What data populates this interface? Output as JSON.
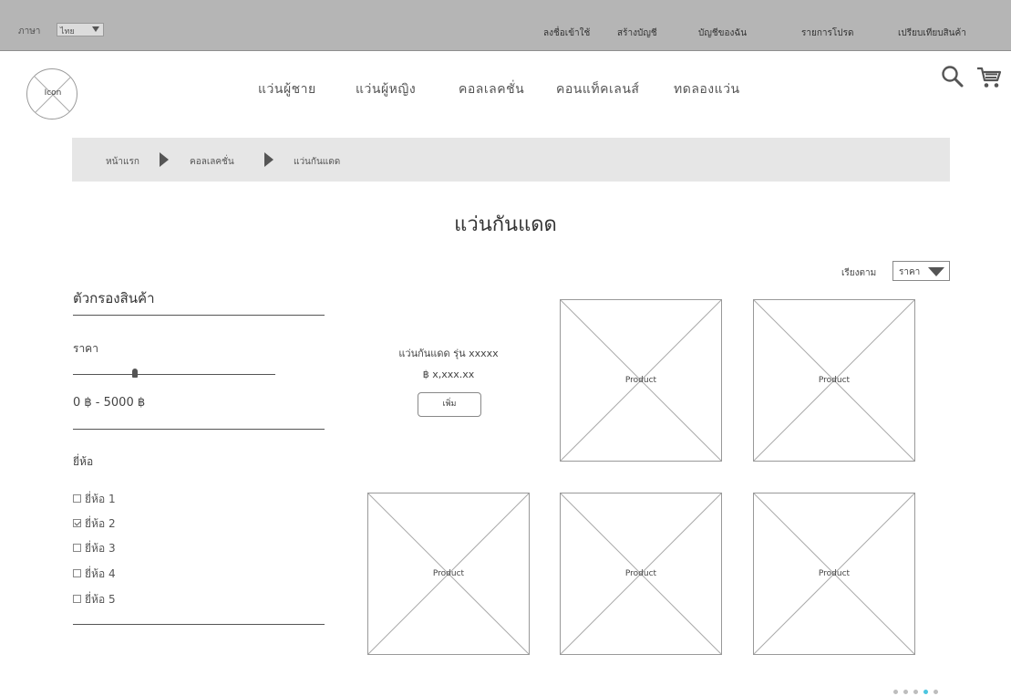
{
  "topbar": {
    "language_label": "ภาษา",
    "language_value": "ไทย",
    "links": [
      "ลงชื่อเข้าใช้",
      "สร้างบัญชี",
      "บัญชีของฉัน",
      "รายการโปรด",
      "เปรียบเทียบสินค้า"
    ]
  },
  "header": {
    "logo_text": "Icon",
    "nav": [
      "แว่นผู้ชาย",
      "แว่นผู้หญิง",
      "คอลเลคชั่น",
      "คอนแท็คเลนส์",
      "ทดลองแว่น"
    ]
  },
  "breadcrumb": [
    "หน้าแรก",
    "คอลเลคชั่น",
    "แว่นกันแดด"
  ],
  "page": {
    "title": "แว่นกันแดด",
    "sort_label": "เรียงตาม",
    "sort_value": "ราคา"
  },
  "filter": {
    "title": "ตัวกรองสินค้า",
    "price_label": "ราคา",
    "price_range": "0 ฿ - 5000 ฿",
    "price_slider_value": 0.3,
    "brand_label": "ยี่ห้อ",
    "brands": [
      {
        "label": "ยี่ห้อ 1",
        "checked": false
      },
      {
        "label": "ยี่ห้อ 2",
        "checked": true
      },
      {
        "label": "ยี่ห้อ 3",
        "checked": false
      },
      {
        "label": "ยี่ห้อ 4",
        "checked": false
      },
      {
        "label": "ยี่ห้อ 5",
        "checked": false
      }
    ]
  },
  "products": {
    "featured": {
      "name": "แว่นกันแดด รุ่น xxxxx",
      "price": "฿ x,xxx.xx",
      "add_label": "เพิ่ม"
    },
    "placeholders": [
      "Product",
      "Product",
      "Product",
      "Product",
      "Product"
    ]
  },
  "pagination": {
    "pages": 5,
    "active_index": 3
  },
  "colors": {
    "topbar": "#b5b5b5",
    "breadcrumb_bg": "#e6e6e6",
    "active_dot": "#4cc6e0"
  }
}
